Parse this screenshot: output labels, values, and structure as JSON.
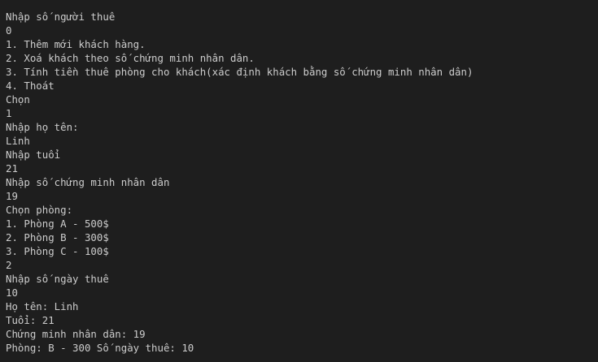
{
  "terminal": {
    "lines": [
      "Nhập số người thuê",
      "0",
      "1. Thêm mới khách hàng.",
      "2. Xoá khách theo số chứng minh nhân dân.",
      "3. Tính tiền thuê phòng cho khách(xác định khách bằng số chứng minh nhân dân)",
      "4. Thoát",
      "Chọn",
      "1",
      "Nhập họ tên:",
      "Linh",
      "Nhập tuổi",
      "21",
      "Nhập số chứng minh nhân dân",
      "19",
      "Chọn phòng:",
      "1. Phòng A - 500$",
      "2. Phòng B - 300$",
      "3. Phòng C - 100$",
      "2",
      "Nhập số ngày thuê",
      "10",
      "Họ tên: Linh",
      "Tuổi: 21",
      "Chứng minh nhân dân: 19",
      "Phòng: B - 300 Số ngày thuê: 10"
    ]
  },
  "colors": {
    "background": "#1e1e1e",
    "text": "#cccccc"
  }
}
